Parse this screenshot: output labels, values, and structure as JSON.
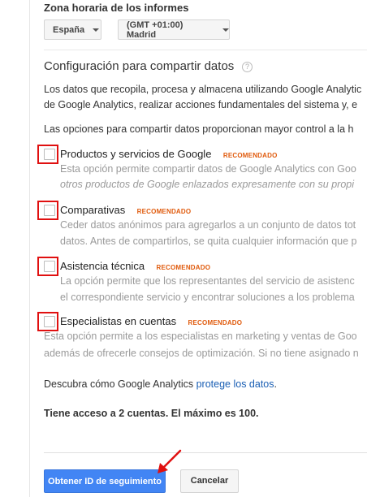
{
  "timezone": {
    "title": "Zona horaria de los informes",
    "country_value": "España",
    "zone_value": "(GMT +01:00) Madrid"
  },
  "sharing": {
    "title": "Configuración para compartir datos",
    "intro_line1": "Los datos que recopila, procesa y almacena utilizando Google Analytic",
    "intro_line2": "de Google Analytics, realizar acciones fundamentales del sistema y, e",
    "options_intro": "Las opciones para compartir datos proporcionan mayor control a la h",
    "recommended_badge": "RECOMENDADO",
    "options": [
      {
        "label": "Productos y servicios de Google",
        "checked": false,
        "desc_line1": "Esta opción permite compartir datos de Google Analytics con Goo",
        "desc_line2": "otros productos de Google enlazados expresamente con su propi"
      },
      {
        "label": "Comparativas",
        "checked": false,
        "desc_line1": "Ceder datos anónimos para agregarlos a un conjunto de datos tot",
        "desc_line2": "datos. Antes de compartirlos, se quita cualquier información que p"
      },
      {
        "label": "Asistencia técnica",
        "checked": false,
        "desc_line1": "La opción permite que los representantes del servicio de asistenc",
        "desc_line2": "el correspondiente servicio y encontrar soluciones a los problema"
      },
      {
        "label": "Especialistas en cuentas",
        "checked": false,
        "desc_line1": "Esta opción permite a los especialistas en marketing y ventas de Goo",
        "desc_line2": "además de ofrecerle consejos de optimización. Si no tiene asignado n"
      }
    ],
    "protect_prefix": "Descubra cómo Google Analytics",
    "protect_link": "protege los datos",
    "protect_suffix": "."
  },
  "accounts_notice": "Tiene acceso a 2 cuentas. El máximo es 100.",
  "buttons": {
    "get_id": "Obtener ID de seguimiento",
    "cancel": "Cancelar"
  },
  "colors": {
    "primary": "#4285f4",
    "recommended": "#e05a0c",
    "annotation_red": "#e01010",
    "link": "#1a5fb4"
  }
}
